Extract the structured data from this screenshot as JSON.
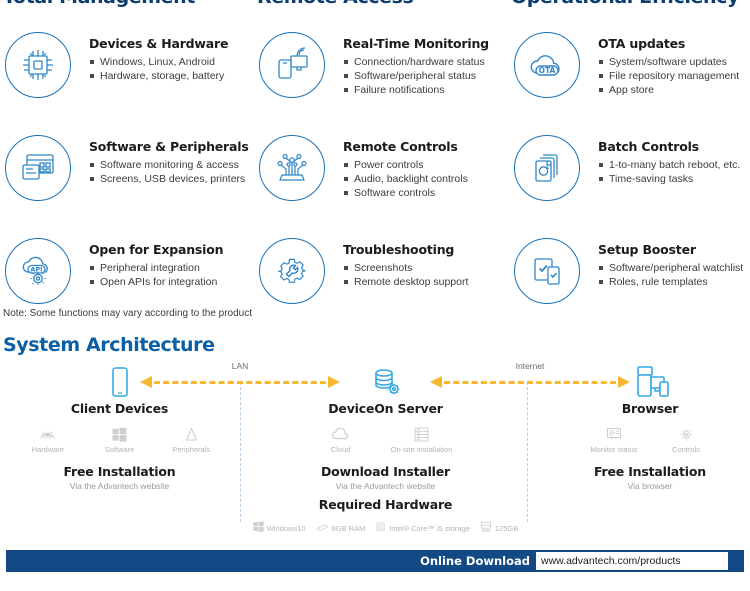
{
  "columns": [
    {
      "header": "Total Management"
    },
    {
      "header": "Remote Access"
    },
    {
      "header": "Operational Efficiency"
    }
  ],
  "features": [
    {
      "icon": "cpu-chip-icon",
      "title": "Devices & Hardware",
      "bullets": [
        "Windows, Linux, Android",
        "Hardware, storage, battery"
      ]
    },
    {
      "icon": "remote-monitor-icon",
      "title": "Real-Time Monitoring",
      "bullets": [
        "Connection/hardware status",
        "Software/peripheral status",
        "Failure notifications"
      ]
    },
    {
      "icon": "cloud-ota-icon",
      "title": "OTA updates",
      "bullets": [
        "System/software updates",
        "File repository management",
        "App store"
      ]
    },
    {
      "icon": "software-peripherals-icon",
      "title": "Software & Peripherals",
      "bullets": [
        "Software monitoring & access",
        "Screens, USB devices, printers"
      ]
    },
    {
      "icon": "circuit-control-icon",
      "title": "Remote Controls",
      "bullets": [
        "Power controls",
        "Audio, backlight controls",
        "Software controls"
      ]
    },
    {
      "icon": "batch-documents-icon",
      "title": "Batch Controls",
      "bullets": [
        "1-to-many batch reboot, etc.",
        "Time-saving tasks"
      ]
    },
    {
      "icon": "api-cloud-gear-icon",
      "title": "Open for Expansion",
      "bullets": [
        "Peripheral integration",
        "Open APIs for integration"
      ]
    },
    {
      "icon": "gear-wrench-icon",
      "title": "Troubleshooting",
      "bullets": [
        "Screenshots",
        "Remote desktop support"
      ]
    },
    {
      "icon": "checklist-devices-icon",
      "title": "Setup Booster",
      "bullets": [
        "Software/peripheral watchlist",
        "Roles, rule templates"
      ]
    }
  ],
  "note": "Note: Some functions may vary according to the product",
  "architecture": {
    "title": "System Architecture",
    "arrows": [
      {
        "label": "LAN"
      },
      {
        "label": "Internet"
      }
    ],
    "nodes": [
      {
        "id": "client-devices",
        "icon": "tablet-icon",
        "name": "Client Devices",
        "subicons": [
          {
            "icon": "android-icon",
            "caption": "Hardware"
          },
          {
            "icon": "windows-icon",
            "caption": "Software"
          },
          {
            "icon": "peripherals-icon",
            "caption": "Peripherals"
          }
        ],
        "headline": "Free Installation",
        "subline": "Via the Advantech website"
      },
      {
        "id": "deviceon-server",
        "icon": "database-gear-icon",
        "name": "DeviceOn Server",
        "subicons": [
          {
            "icon": "cloud-icon",
            "caption": "Cloud"
          },
          {
            "icon": "server-rack-icon",
            "caption": "On-site installation"
          }
        ],
        "headline": "Download Installer",
        "subline": "Via the Advantech website",
        "requirements_title": "Required Hardware",
        "requirements": [
          {
            "icon": "windows-icon",
            "caption": "Windows10"
          },
          {
            "icon": "ram-icon",
            "caption": "8GB RAM"
          },
          {
            "icon": "cpu-icon",
            "caption": "Intel® Core™ i5 storage"
          },
          {
            "icon": "storage-icon",
            "caption": "125GB"
          }
        ]
      },
      {
        "id": "browser",
        "icon": "multi-devices-icon",
        "name": "Browser",
        "subicons": [
          {
            "icon": "monitor-status-icon",
            "caption": "Monitor status"
          },
          {
            "icon": "controls-gear-icon",
            "caption": "Controls"
          }
        ],
        "headline": "Free Installation",
        "subline": "Via browser"
      }
    ]
  },
  "footer": {
    "label": "Online Download",
    "url": "www.advantech.com/products"
  },
  "colors": {
    "header_blue": "#0b3d70",
    "section_blue": "#0b5fa5",
    "icon_blue": "#1b72b8",
    "arrow_yellow": "#f5b82e",
    "bar_blue": "#134a86"
  }
}
